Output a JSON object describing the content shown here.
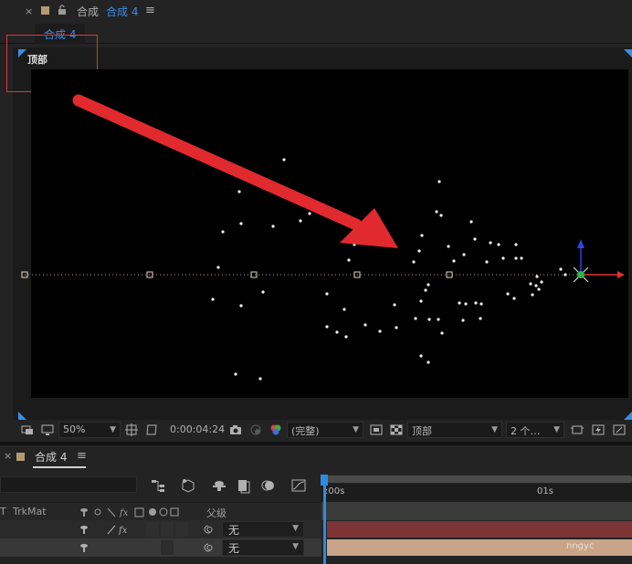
{
  "comp_panel": {
    "close_glyph": "×",
    "label": "合成",
    "comp_name": "合成 4",
    "menu_glyph": "≡",
    "subtab": "合成 4"
  },
  "viewer": {
    "view_label": "顶部",
    "highlight_color": "#e3333a",
    "accent_color": "#3a8ee6"
  },
  "viewer_toolbar": {
    "zoom": "50%",
    "timecode": "0:00:04:24",
    "resolution": "(完整)",
    "view": "顶部",
    "views_count": "2 个…"
  },
  "timeline": {
    "close_glyph": "×",
    "comp_name": "合成 4",
    "menu_glyph": "≡",
    "columns": {
      "t": "T",
      "trkmat": "TrkMat",
      "parent": "父级"
    },
    "ruler": {
      "start": ":00s",
      "mark_1s": "01s"
    },
    "layers": [
      {
        "parent": "无",
        "color": "#7c3436"
      },
      {
        "parent": "无",
        "color": "#c9a489",
        "bar_text": "nngyc"
      }
    ]
  }
}
